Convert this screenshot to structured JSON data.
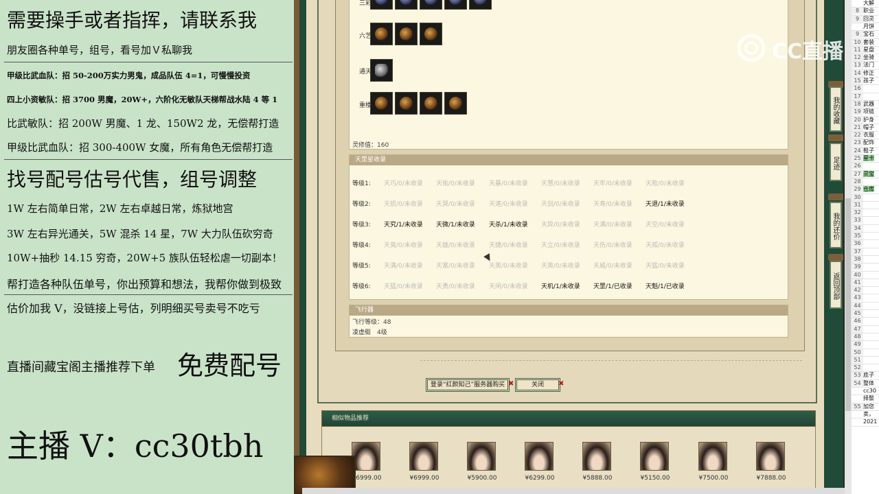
{
  "overlay": {
    "title": "需要操手或者指挥，请联系我",
    "line2": "朋友圈各种单号，组号，看号加Ｖ私聊我",
    "line3": "甲级比武血队：招 50-200万实力男鬼，成品队伍 4=1，可慢慢投资",
    "line4": "四上小资敏队：招 3700 男魔，20W+，六阶化无敏队天梯帮战水陆 4 等 1",
    "line5": "比武敏队：招 200W 男魔、1 龙、150W2 龙，无偿帮打造",
    "line6": "甲级比武血队：招 300-400W 女魔，所有角色无偿帮打造",
    "headline2": "找号配号估号代售，组号调整",
    "line8": "1W 左右简单日常，2W 左右卓越日常，炼狱地宫",
    "line9": "3W 左右异光通关，5W 混杀 14 星，7W 大力队伍砍穷奇",
    "line10": "10W+抽秒 14.15 穷奇，20W+5 族队伍轻松虐一切副本！",
    "line11": "帮打造各种队伍单号，你出预算和想法，我帮你做到极致",
    "line12": "估价加我 V，没链接上号估，列明细买号卖号不吃亏",
    "recommend": "直播间藏宝阁主播推荐下单",
    "free": "免费配号",
    "anchor": "主播 V：cc30tbh"
  },
  "equip": {
    "row1_label": "三彩:",
    "row2_label": "六艺:",
    "row3_label": "通天:",
    "row4_label": "重楼:",
    "lingxiu": "灵修值：160"
  },
  "tianzhen": {
    "header": "天罡星收录",
    "levels": [
      "等级1:",
      "等级2:",
      "等级3:",
      "等级4:",
      "等级5:",
      "等级6:"
    ],
    "rows": [
      [
        {
          "t": "天巧/0/未收录",
          "on": false
        },
        {
          "t": "天佑/0/未收录",
          "on": false
        },
        {
          "t": "天暴/0/未收录",
          "on": false
        },
        {
          "t": "天慧/0/未收录",
          "on": false
        },
        {
          "t": "天牢/0/未收录",
          "on": false
        },
        {
          "t": "天败/0/未收录",
          "on": false
        }
      ],
      [
        {
          "t": "天损/0/未收录",
          "on": false
        },
        {
          "t": "天哭/0/未收录",
          "on": false
        },
        {
          "t": "天速/0/未收录",
          "on": false
        },
        {
          "t": "天剑/0/未收录",
          "on": false
        },
        {
          "t": "天寿/0/未收录",
          "on": false
        },
        {
          "t": "天退/1/未收录",
          "on": true
        }
      ],
      [
        {
          "t": "天究/1/未收录",
          "on": true
        },
        {
          "t": "天微/1/未收录",
          "on": true
        },
        {
          "t": "天杀/1/未收录",
          "on": true
        },
        {
          "t": "天异/0/未收录",
          "on": false
        },
        {
          "t": "天满/0/未收录",
          "on": false
        },
        {
          "t": "天空/0/未收录",
          "on": false
        }
      ],
      [
        {
          "t": "天竟/0/未收录",
          "on": false
        },
        {
          "t": "天雄/0/未收录",
          "on": false
        },
        {
          "t": "天捷/0/未收录",
          "on": false
        },
        {
          "t": "天立/0/未收录",
          "on": false
        },
        {
          "t": "天伤/0/未收录",
          "on": false
        },
        {
          "t": "天孤/0/未收录",
          "on": false
        }
      ],
      [
        {
          "t": "天满/0/未收录",
          "on": false
        },
        {
          "t": "天富/0/未收录",
          "on": false
        },
        {
          "t": "天英/0/未收录",
          "on": false
        },
        {
          "t": "天英/0/未收录",
          "on": false
        },
        {
          "t": "天威/0/未收录",
          "on": false
        },
        {
          "t": "天猛/0/未收录",
          "on": false
        }
      ],
      [
        {
          "t": "天猛/0/未收录",
          "on": false
        },
        {
          "t": "天勇/0/未收录",
          "on": false
        },
        {
          "t": "天闲/0/未收录",
          "on": false
        },
        {
          "t": "天机/1/未收录",
          "on": true
        },
        {
          "t": "天罡/1/已收录",
          "on": true
        },
        {
          "t": "天魁/1/已收录",
          "on": true
        }
      ]
    ]
  },
  "flying": {
    "header": "飞行器",
    "level": "飞行等级：48",
    "item": "凌虚艇　4级"
  },
  "buttons": {
    "login": "登录“红颜知己”服务器购买",
    "close": "关闭",
    "x_mark": "✖"
  },
  "related": {
    "title": "相似物品推荐",
    "prices": [
      "¥6999.00",
      "¥6999.00",
      "¥5900.00",
      "¥6299.00",
      "¥5888.00",
      "¥5150.00",
      "¥7500.00",
      "¥7888.00"
    ]
  },
  "rail": {
    "favorites": "我的收藏",
    "footprint": "足迹",
    "bargain": "我的还价",
    "top": "返回顶部"
  },
  "excel": {
    "rows": [
      {
        "n": "",
        "t": "大解"
      },
      {
        "n": "8",
        "t": "职业"
      },
      {
        "n": "9",
        "t": "回灵"
      },
      {
        "n": "",
        "t": "月饼"
      },
      {
        "n": "9",
        "t": "宝石"
      },
      {
        "n": "10",
        "t": "套装"
      },
      {
        "n": "11",
        "t": "星盘"
      },
      {
        "n": "12",
        "t": "坐骑"
      },
      {
        "n": "13",
        "t": "法门"
      },
      {
        "n": "14",
        "t": "修正"
      },
      {
        "n": "15",
        "t": "孩子"
      },
      {
        "n": "16",
        "t": ""
      },
      {
        "n": "17",
        "t": ""
      },
      {
        "n": "18",
        "t": "武器"
      },
      {
        "n": "19",
        "t": "项链"
      },
      {
        "n": "20",
        "t": "护身"
      },
      {
        "n": "21",
        "t": "帽子"
      },
      {
        "n": "22",
        "t": "衣服"
      },
      {
        "n": "23",
        "t": "配饰"
      },
      {
        "n": "24",
        "t": "鞋子"
      },
      {
        "n": "25",
        "t": "星卡",
        "g": true
      },
      {
        "n": "26",
        "t": ""
      },
      {
        "n": "27",
        "t": "灵宝",
        "g": true
      },
      {
        "n": "28",
        "t": ""
      },
      {
        "n": "29",
        "t": "仓库",
        "g": true
      },
      {
        "n": "30",
        "t": ""
      },
      {
        "n": "31",
        "t": ""
      },
      {
        "n": "32",
        "t": ""
      },
      {
        "n": "33",
        "t": ""
      },
      {
        "n": "34",
        "t": ""
      },
      {
        "n": "35",
        "t": ""
      },
      {
        "n": "36",
        "t": ""
      },
      {
        "n": "37",
        "t": ""
      },
      {
        "n": "38",
        "t": ""
      },
      {
        "n": "39",
        "t": ""
      },
      {
        "n": "40",
        "t": ""
      },
      {
        "n": "41",
        "t": ""
      },
      {
        "n": "42",
        "t": ""
      },
      {
        "n": "43",
        "t": ""
      },
      {
        "n": "44",
        "t": ""
      },
      {
        "n": "45",
        "t": ""
      },
      {
        "n": "46",
        "t": ""
      },
      {
        "n": "47",
        "t": ""
      },
      {
        "n": "48",
        "t": ""
      },
      {
        "n": "49",
        "t": ""
      },
      {
        "n": "50",
        "t": ""
      },
      {
        "n": "51",
        "t": ""
      },
      {
        "n": "52",
        "t": ""
      },
      {
        "n": "53",
        "t": "底子"
      },
      {
        "n": "54",
        "t": "整体"
      },
      {
        "n": "",
        "t": "cc30"
      },
      {
        "n": "",
        "t": "择鬃"
      },
      {
        "n": "55",
        "t": "加您"
      },
      {
        "n": "",
        "t": "卖，"
      },
      {
        "n": "",
        "t": "2021"
      }
    ]
  },
  "watermark": {
    "text": "CC直播"
  },
  "colors": {
    "panel_green": "#c9e3c9",
    "game_green": "#1f4b38",
    "parchment": "#fbf7e0",
    "close_x": "#c01818"
  }
}
